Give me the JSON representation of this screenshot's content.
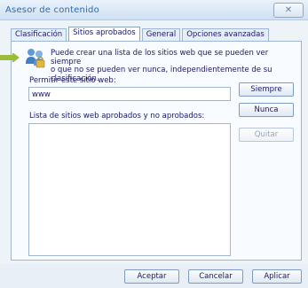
{
  "window": {
    "title": "Asesor de contenido"
  },
  "tabs": [
    {
      "label": "Clasificación",
      "active": false
    },
    {
      "label": "Sitios aprobados",
      "active": true
    },
    {
      "label": "General",
      "active": false
    },
    {
      "label": "Opciones avanzadas",
      "active": false
    }
  ],
  "panel": {
    "intro_line1": "Puede crear una lista de los sitios web que se pueden ver siempre",
    "intro_line2": "o que no se pueden ver nunca, independientemente de su",
    "intro_line3": "clasificación.",
    "allow_label": "Permitir este sitio web:",
    "site_value": "www",
    "list_label": "Lista de sitios web aprobados y no aprobados:",
    "always_button": "Siempre",
    "never_button": "Nunca",
    "remove_button": "Quitar"
  },
  "footer": {
    "ok_button": "Aceptar",
    "cancel_button": "Cancelar",
    "apply_button": "Aplicar"
  },
  "icons": {
    "header_icon": "users-lock-icon",
    "pointer": "arrow-right-icon"
  },
  "colors": {
    "accent_arrow": "#9bbd3b",
    "title_text": "#2b6db0",
    "text": "#1a1a66"
  }
}
